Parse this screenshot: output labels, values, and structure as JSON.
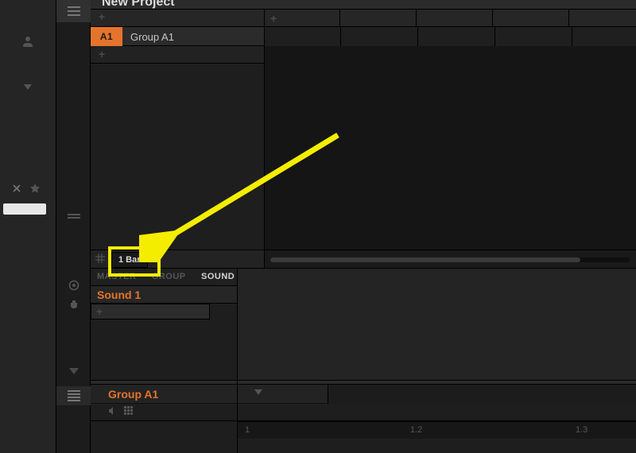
{
  "project": {
    "title": "New Project"
  },
  "scene": {
    "add_icon": "+",
    "first": "+"
  },
  "group": {
    "badge": "A1",
    "name": "Group A1",
    "add": "+"
  },
  "pattern": {
    "length": "1 Bar"
  },
  "channel_tabs": {
    "master": "MASTER",
    "group": "GROUP",
    "sound": "SOUND"
  },
  "sound": {
    "name": "Sound 1",
    "add": "+"
  },
  "footer": {
    "group_name": "Group A1"
  },
  "timeline": {
    "t1": "1",
    "t2": "1.2",
    "t3": "1.3"
  },
  "colors": {
    "accent": "#e4742c",
    "highlight": "#f4ed00"
  }
}
